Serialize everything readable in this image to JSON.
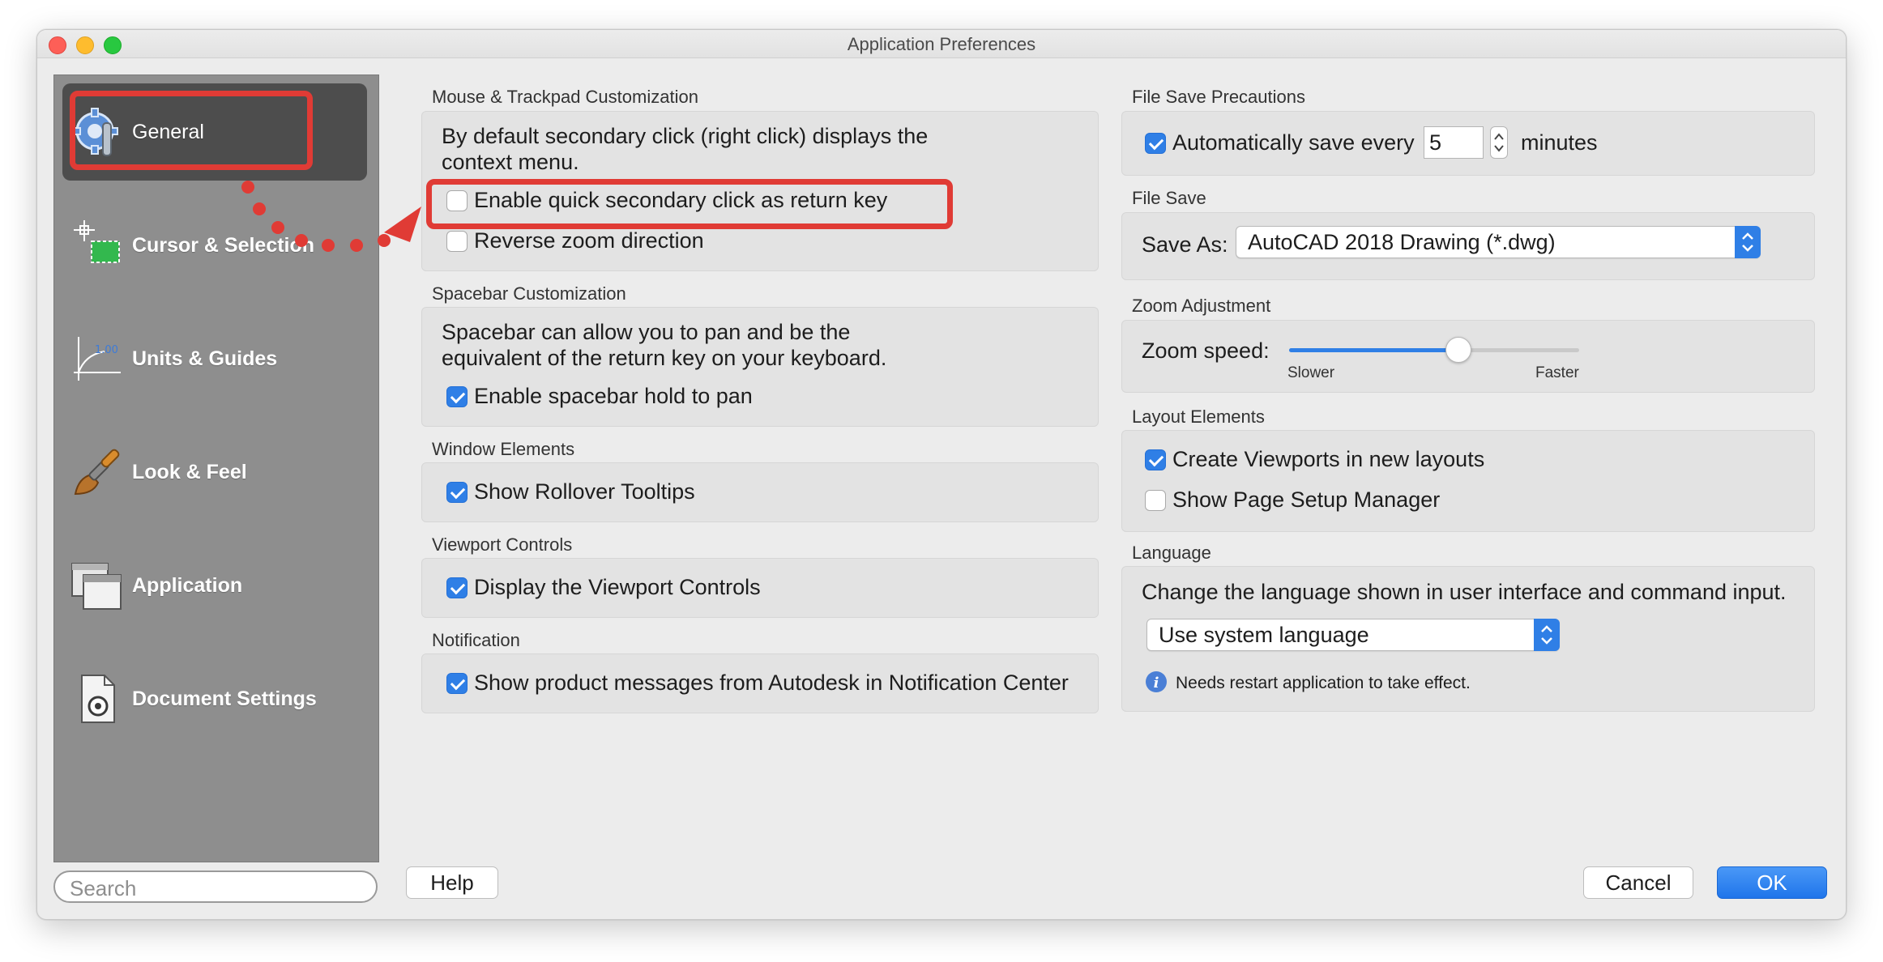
{
  "window": {
    "title": "Application Preferences"
  },
  "sidebar": {
    "items": [
      {
        "label": "General",
        "icon": "gear-wrench-icon",
        "selected": true
      },
      {
        "label": "Cursor & Selection",
        "icon": "cursor-selection-icon"
      },
      {
        "label": "Units & Guides",
        "icon": "units-guides-icon"
      },
      {
        "label": "Look & Feel",
        "icon": "paintbrush-icon"
      },
      {
        "label": "Application",
        "icon": "application-windows-icon"
      },
      {
        "label": "Document Settings",
        "icon": "document-settings-icon"
      }
    ],
    "search_placeholder": "Search"
  },
  "mouse": {
    "title": "Mouse & Trackpad Customization",
    "desc_line1": "By default secondary click (right click) displays the",
    "desc_line2": "context menu.",
    "quick_secondary": {
      "label": "Enable quick secondary click as return key",
      "checked": false
    },
    "reverse_zoom": {
      "label": "Reverse zoom direction",
      "checked": false
    }
  },
  "spacebar": {
    "title": "Spacebar Customization",
    "desc_line1": "Spacebar can allow you to pan and be the",
    "desc_line2": "equivalent of the return key on your keyboard.",
    "hold_pan": {
      "label": "Enable spacebar hold to pan",
      "checked": true
    }
  },
  "window_elements": {
    "title": "Window Elements",
    "tooltips": {
      "label": "Show Rollover Tooltips",
      "checked": true
    }
  },
  "viewport_controls": {
    "title": "Viewport Controls",
    "display": {
      "label": "Display the Viewport Controls",
      "checked": true
    }
  },
  "notification": {
    "title": "Notification",
    "messages": {
      "label": "Show product messages from Autodesk in Notification Center",
      "checked": true
    }
  },
  "file_save_precautions": {
    "title": "File Save Precautions",
    "autosave_label": "Automatically save every",
    "autosave_checked": true,
    "minutes_value": "5",
    "minutes_label": "minutes"
  },
  "file_save": {
    "title": "File Save",
    "save_as_label": "Save As:",
    "save_as_value": "AutoCAD 2018 Drawing (*.dwg)"
  },
  "zoom": {
    "title": "Zoom Adjustment",
    "speed_label": "Zoom speed:",
    "slower": "Slower",
    "faster": "Faster",
    "level_fraction": 0.58
  },
  "layout_elements": {
    "title": "Layout Elements",
    "create_viewports": {
      "label": "Create Viewports in new layouts",
      "checked": true
    },
    "page_setup": {
      "label": "Show Page Setup Manager",
      "checked": false
    }
  },
  "language": {
    "title": "Language",
    "desc": "Change the language shown in user interface and command input.",
    "value": "Use system language",
    "note": "Needs restart application to take effect."
  },
  "buttons": {
    "help": "Help",
    "cancel": "Cancel",
    "ok": "OK"
  },
  "colors": {
    "accent": "#2f7fe6",
    "annotation": "#e03b35",
    "sidebar": "#8e8e8e",
    "selected": "#4d4d4d"
  }
}
